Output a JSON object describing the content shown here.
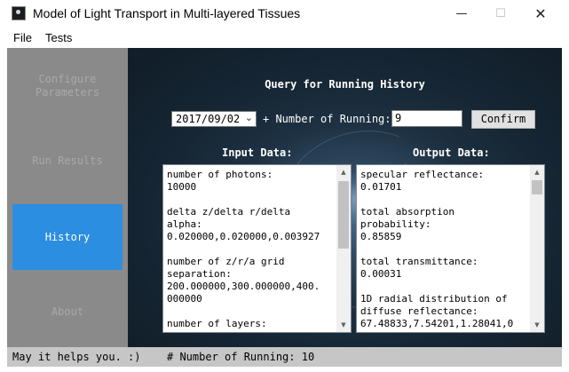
{
  "window": {
    "title": "Model of Light Transport in Multi-layered Tissues",
    "minimize_glyph": "—",
    "maximize_glyph": "☐",
    "close_glyph": "✕"
  },
  "menu": [
    "File",
    "Tests"
  ],
  "sidebar": {
    "items": [
      {
        "label": "Configure\nParameters",
        "state": "disabled"
      },
      {
        "label": "Run Results",
        "state": "disabled"
      },
      {
        "label": "History",
        "state": "active"
      },
      {
        "label": "About",
        "state": "disabled"
      }
    ]
  },
  "history": {
    "heading": "Query for Running History",
    "date_value": "2017/09/02",
    "running_label": "+ Number of Running:",
    "running_value": "9",
    "confirm_label": "Confirm",
    "input_label": "Input Data:",
    "output_label": "Output Data:",
    "input_text": "number of photons:\n10000\n\ndelta z/delta r/delta\nalpha:\n0.020000,0.020000,0.003927\n\nnumber of z/r/a grid\nseparation:\n200.000000,300.000000,400.\n000000\n\nnumber of layers:",
    "output_text": "specular reflectance:\n0.01701\n\ntotal absorption\nprobability:\n0.85859\n\ntotal transmittance:\n0.00031\n\n1D radial distribution of\ndiffuse reflectance:\n67.48833,7.54201,1.28041,0"
  },
  "status": {
    "left": "May it helps you. :)",
    "right": "# Number of Running: 10"
  },
  "colors": {
    "active_tab": "#2b8ee0",
    "sidebar_bg": "#8a8a8a",
    "main_bg": "#1e3142",
    "status_bg": "#c6c6c6"
  },
  "icons": {
    "app": "app-logo-icon",
    "dropdown": "chevron-down-icon",
    "scroll_up": "arrow-up-icon",
    "scroll_down": "arrow-down-icon"
  }
}
